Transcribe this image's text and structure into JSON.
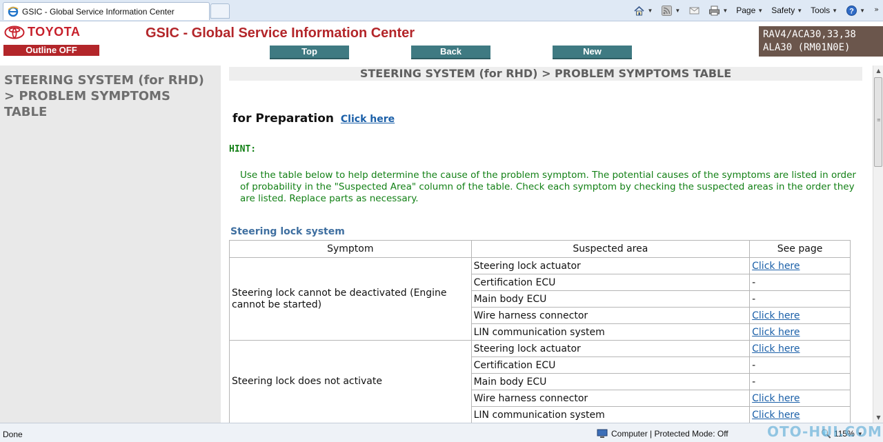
{
  "browser": {
    "tab_title": "GSIC - Global Service Information Center",
    "commands": {
      "page": "Page",
      "safety": "Safety",
      "tools": "Tools"
    },
    "help_icon_label": "?"
  },
  "header": {
    "brand": "TOYOTA",
    "outline_button": "Outline OFF",
    "title": "GSIC - Global Service Information Center",
    "nav": {
      "top": "Top",
      "back": "Back",
      "new": "New"
    },
    "model_line1": "RAV4/ACA30,33,38",
    "model_line2": "ALA30 (RM01N0E)"
  },
  "sidebar": {
    "title": "STEERING SYSTEM (for RHD) > PROBLEM SYMPTOMS TABLE"
  },
  "content": {
    "section_title": "STEERING SYSTEM (for RHD) > PROBLEM SYMPTOMS TABLE",
    "preparation_label": "for Preparation",
    "preparation_link": "Click here",
    "hint_label": "HINT:",
    "hint_text": "Use the table below to help determine the cause of the problem symptom. The potential causes of the symptoms are listed in order of probability in the \"Suspected Area\" column of the table. Check each symptom by checking the suspected areas in the order they are listed. Replace parts as necessary.",
    "subsection": "Steering lock system",
    "table": {
      "headers": [
        "Symptom",
        "Suspected area",
        "See page"
      ],
      "groups": [
        {
          "symptom": "Steering lock cannot be deactivated (Engine cannot be started)",
          "rows": [
            {
              "area": "Steering lock actuator",
              "page": "Click here"
            },
            {
              "area": "Certification ECU",
              "page": "-"
            },
            {
              "area": "Main body ECU",
              "page": "-"
            },
            {
              "area": "Wire harness connector",
              "page": "Click here"
            },
            {
              "area": "LIN communication system",
              "page": "Click here"
            }
          ]
        },
        {
          "symptom": "Steering lock does not activate",
          "rows": [
            {
              "area": "Steering lock actuator",
              "page": "Click here"
            },
            {
              "area": "Certification ECU",
              "page": "-"
            },
            {
              "area": "Main body ECU",
              "page": "-"
            },
            {
              "area": "Wire harness connector",
              "page": "Click here"
            },
            {
              "area": "LIN communication system",
              "page": "Click here"
            }
          ]
        }
      ]
    }
  },
  "status": {
    "text": "Done",
    "zone": "Computer | Protected Mode: Off",
    "zoom": "115%",
    "watermark": "OTO-HUI.COM"
  },
  "colors": {
    "brand_red": "#b3262a",
    "nav_teal": "#3f7a82",
    "hint_green": "#128015",
    "link_blue": "#1a5fa8"
  }
}
